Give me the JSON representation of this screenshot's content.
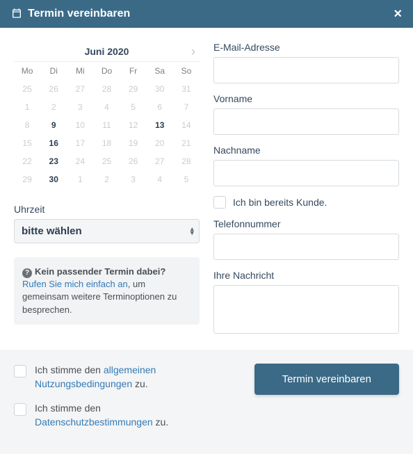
{
  "header": {
    "title": "Termin vereinbaren"
  },
  "calendar": {
    "month_label": "Juni 2020",
    "weekdays": [
      "Mo",
      "Di",
      "Mi",
      "Do",
      "Fr",
      "Sa",
      "So"
    ],
    "days": [
      {
        "n": 25,
        "avail": false
      },
      {
        "n": 26,
        "avail": false
      },
      {
        "n": 27,
        "avail": false
      },
      {
        "n": 28,
        "avail": false
      },
      {
        "n": 29,
        "avail": false
      },
      {
        "n": 30,
        "avail": false
      },
      {
        "n": 31,
        "avail": false
      },
      {
        "n": 1,
        "avail": false
      },
      {
        "n": 2,
        "avail": false
      },
      {
        "n": 3,
        "avail": false
      },
      {
        "n": 4,
        "avail": false
      },
      {
        "n": 5,
        "avail": false
      },
      {
        "n": 6,
        "avail": false
      },
      {
        "n": 7,
        "avail": false
      },
      {
        "n": 8,
        "avail": false
      },
      {
        "n": 9,
        "avail": true
      },
      {
        "n": 10,
        "avail": false
      },
      {
        "n": 11,
        "avail": false
      },
      {
        "n": 12,
        "avail": false
      },
      {
        "n": 13,
        "avail": true
      },
      {
        "n": 14,
        "avail": false
      },
      {
        "n": 15,
        "avail": false
      },
      {
        "n": 16,
        "avail": true
      },
      {
        "n": 17,
        "avail": false
      },
      {
        "n": 18,
        "avail": false
      },
      {
        "n": 19,
        "avail": false
      },
      {
        "n": 20,
        "avail": false
      },
      {
        "n": 21,
        "avail": false
      },
      {
        "n": 22,
        "avail": false
      },
      {
        "n": 23,
        "avail": true
      },
      {
        "n": 24,
        "avail": false
      },
      {
        "n": 25,
        "avail": false
      },
      {
        "n": 26,
        "avail": false
      },
      {
        "n": 27,
        "avail": false
      },
      {
        "n": 28,
        "avail": false
      },
      {
        "n": 29,
        "avail": false
      },
      {
        "n": 30,
        "avail": true
      },
      {
        "n": 1,
        "avail": false
      },
      {
        "n": 2,
        "avail": false
      },
      {
        "n": 3,
        "avail": false
      },
      {
        "n": 4,
        "avail": false
      },
      {
        "n": 5,
        "avail": false
      }
    ]
  },
  "time": {
    "label": "Uhrzeit",
    "placeholder": "bitte wählen"
  },
  "note": {
    "title": "Kein passender Termin dabei?",
    "link": "Rufen Sie mich einfach an",
    "rest": ", um gemeinsam weitere Terminoptionen zu besprechen."
  },
  "form": {
    "email_label": "E-Mail-Adresse",
    "firstname_label": "Vorname",
    "lastname_label": "Nachname",
    "existing_customer_label": "Ich bin bereits Kunde.",
    "phone_label": "Telefonnummer",
    "message_label": "Ihre Nachricht"
  },
  "footer": {
    "terms_pre": "Ich stimme den ",
    "terms_link": "allgemeinen Nutzungsbedingungen",
    "terms_post": " zu.",
    "privacy_pre": "Ich stimme den ",
    "privacy_link": "Datenschutzbestimmungen",
    "privacy_post": " zu.",
    "submit_label": "Termin vereinbaren"
  }
}
